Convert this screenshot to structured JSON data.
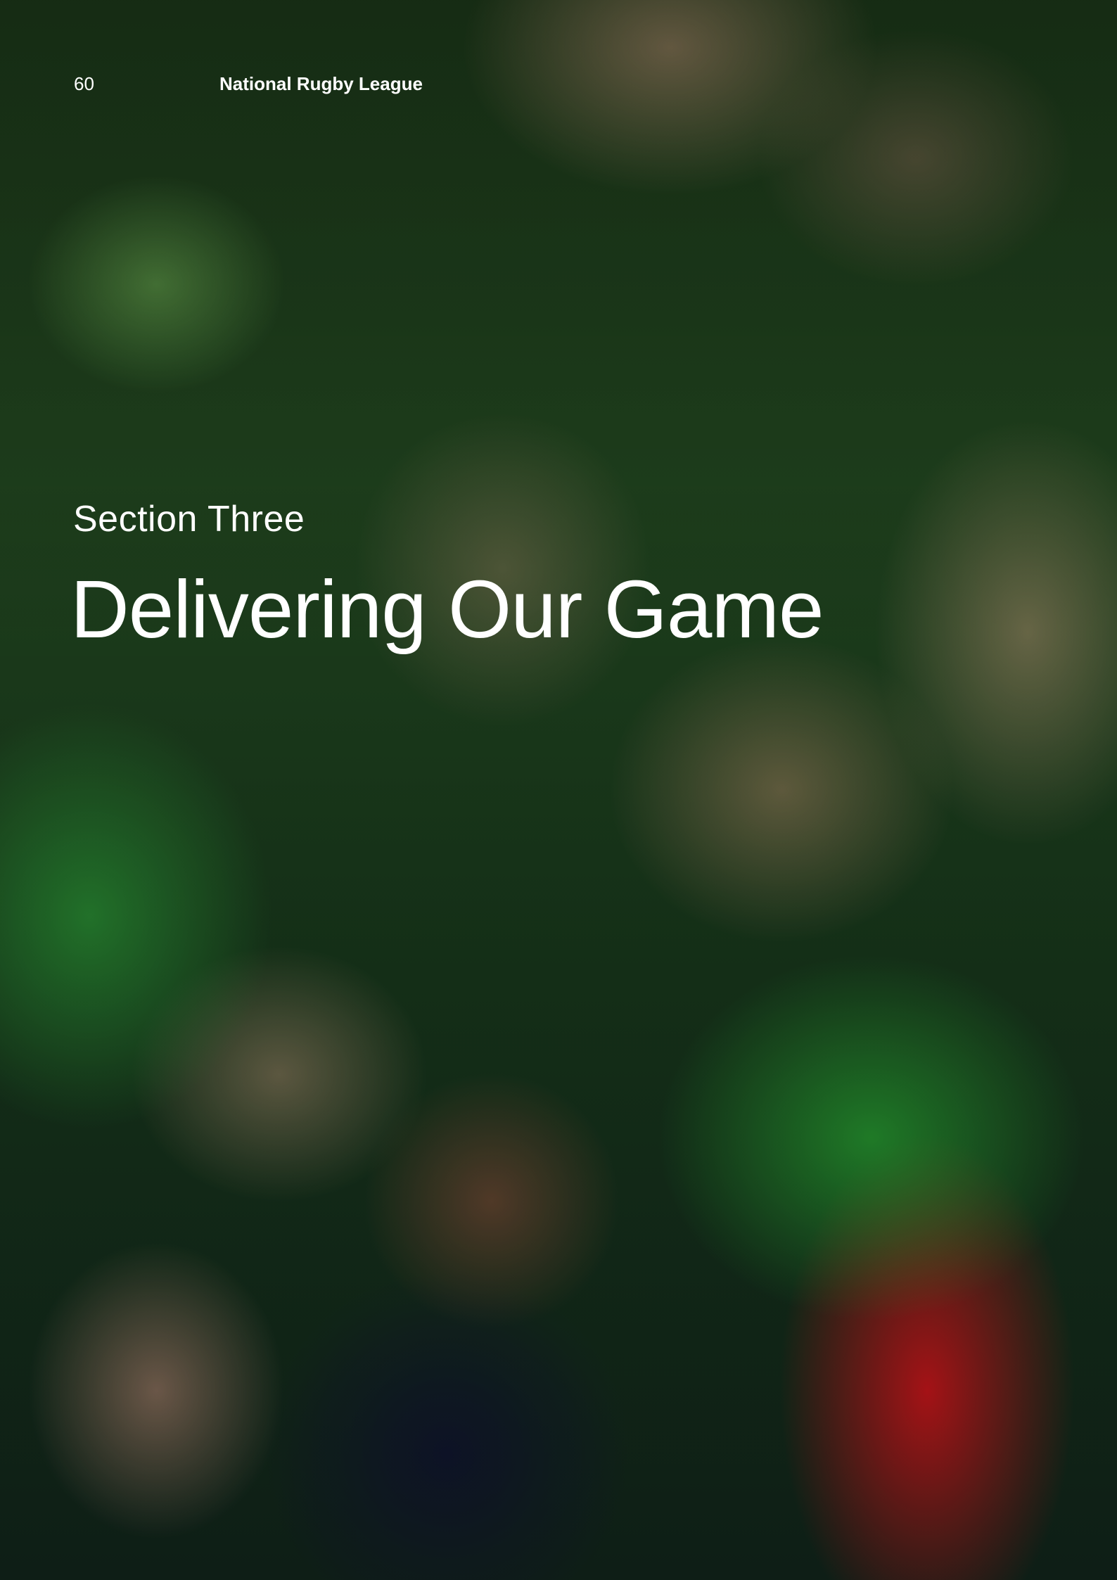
{
  "header": {
    "page_number": "60",
    "document_title": "National Rugby League"
  },
  "section": {
    "label": "Section Three",
    "title": "Delivering Our Game"
  }
}
